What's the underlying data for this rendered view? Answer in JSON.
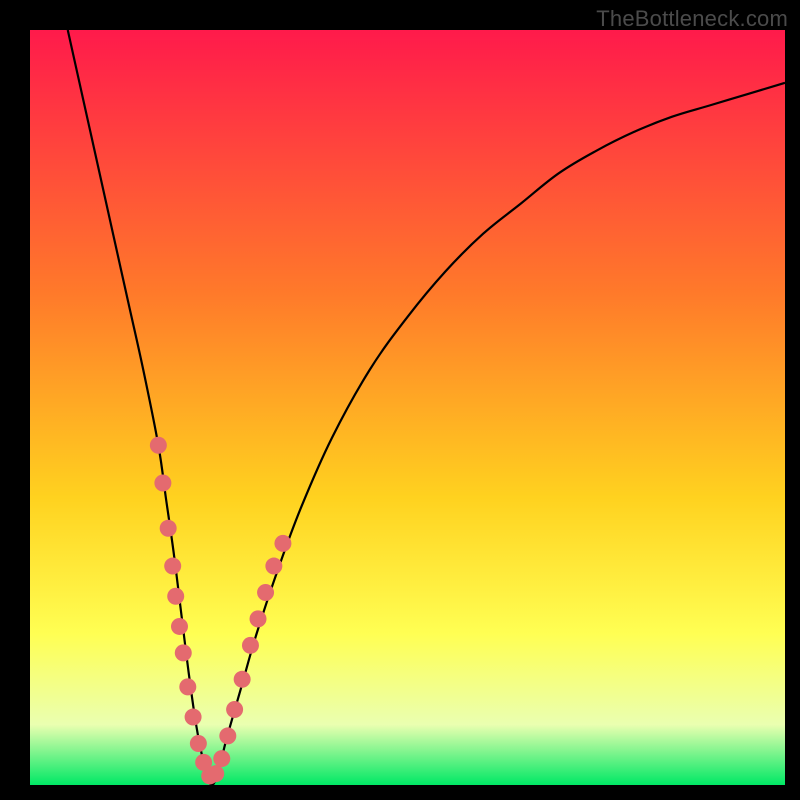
{
  "watermark": "TheBottleneck.com",
  "colors": {
    "bg_black": "#000000",
    "curve": "#000000",
    "dot_fill": "#e46a6f",
    "dot_stroke": "#c94f54",
    "grad_top": "#ff1a4b",
    "grad_mid1": "#ff7a2a",
    "grad_mid2": "#ffd21f",
    "grad_mid3": "#ffff53",
    "grad_low": "#eaffb0",
    "grad_green": "#00e865"
  },
  "chart_data": {
    "type": "line",
    "title": "",
    "xlabel": "",
    "ylabel": "",
    "xlim": [
      0,
      100
    ],
    "ylim": [
      0,
      100
    ],
    "series": [
      {
        "name": "bottleneck-curve",
        "x": [
          5,
          7,
          9,
          11,
          13,
          15,
          17,
          18,
          19,
          20,
          21,
          22,
          23,
          24,
          25,
          26,
          28,
          30,
          33,
          36,
          40,
          45,
          50,
          55,
          60,
          65,
          70,
          75,
          80,
          85,
          90,
          95,
          100
        ],
        "y": [
          100,
          91,
          82,
          73,
          64,
          55,
          45,
          38,
          31,
          23,
          15,
          8,
          3,
          0,
          2,
          6,
          13,
          20,
          29,
          37,
          46,
          55,
          62,
          68,
          73,
          77,
          81,
          84,
          86.5,
          88.5,
          90,
          91.5,
          93
        ]
      }
    ],
    "dots": [
      {
        "x": 17.0,
        "y": 45
      },
      {
        "x": 17.6,
        "y": 40
      },
      {
        "x": 18.3,
        "y": 34
      },
      {
        "x": 18.9,
        "y": 29
      },
      {
        "x": 19.3,
        "y": 25
      },
      {
        "x": 19.8,
        "y": 21
      },
      {
        "x": 20.3,
        "y": 17.5
      },
      {
        "x": 20.9,
        "y": 13
      },
      {
        "x": 21.6,
        "y": 9
      },
      {
        "x": 22.3,
        "y": 5.5
      },
      {
        "x": 23.0,
        "y": 3
      },
      {
        "x": 23.8,
        "y": 1.2
      },
      {
        "x": 24.6,
        "y": 1.5
      },
      {
        "x": 25.4,
        "y": 3.5
      },
      {
        "x": 26.2,
        "y": 6.5
      },
      {
        "x": 27.1,
        "y": 10
      },
      {
        "x": 28.1,
        "y": 14
      },
      {
        "x": 29.2,
        "y": 18.5
      },
      {
        "x": 30.2,
        "y": 22
      },
      {
        "x": 31.2,
        "y": 25.5
      },
      {
        "x": 32.3,
        "y": 29
      },
      {
        "x": 33.5,
        "y": 32
      }
    ],
    "gradient_stops": [
      {
        "pct": 0,
        "value": 100
      },
      {
        "pct": 35,
        "value": 65
      },
      {
        "pct": 62,
        "value": 38
      },
      {
        "pct": 80,
        "value": 20
      },
      {
        "pct": 92,
        "value": 8
      },
      {
        "pct": 100,
        "value": 0
      }
    ]
  }
}
